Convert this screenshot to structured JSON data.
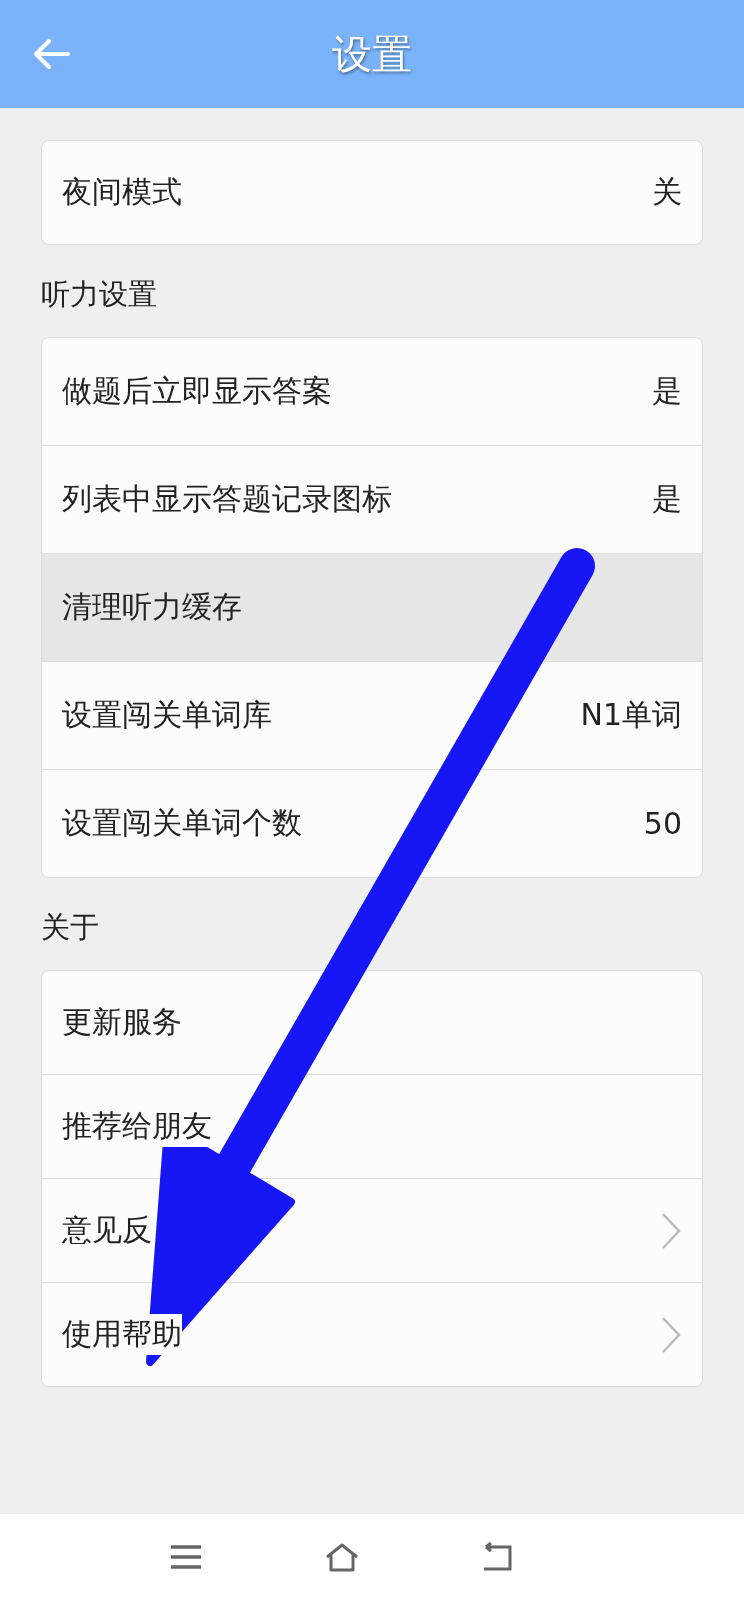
{
  "header": {
    "title": "设置"
  },
  "sections": [
    {
      "rows": [
        {
          "label": "夜间模式",
          "value": "关",
          "kind": "value",
          "highlighted": false
        }
      ]
    },
    {
      "title": "听力设置",
      "rows": [
        {
          "label": "做题后立即显示答案",
          "value": "是",
          "kind": "value",
          "highlighted": false
        },
        {
          "label": "列表中显示答题记录图标",
          "value": "是",
          "kind": "value",
          "highlighted": false
        },
        {
          "label": "清理听力缓存",
          "kind": "plain",
          "highlighted": true
        },
        {
          "label": "设置闯关单词库",
          "value": "N1单词",
          "kind": "value",
          "highlighted": false
        },
        {
          "label": "设置闯关单词个数",
          "value": "50",
          "kind": "value",
          "highlighted": false
        }
      ]
    },
    {
      "title": "关于",
      "rows": [
        {
          "label": "更新服务",
          "kind": "plain",
          "highlighted": false
        },
        {
          "label": "推荐给朋友",
          "kind": "plain",
          "highlighted": false
        },
        {
          "label": "意见反",
          "kind": "chevron",
          "highlighted": false
        },
        {
          "label": "使用帮助",
          "kind": "chevron",
          "highlighted": false
        }
      ]
    }
  ]
}
